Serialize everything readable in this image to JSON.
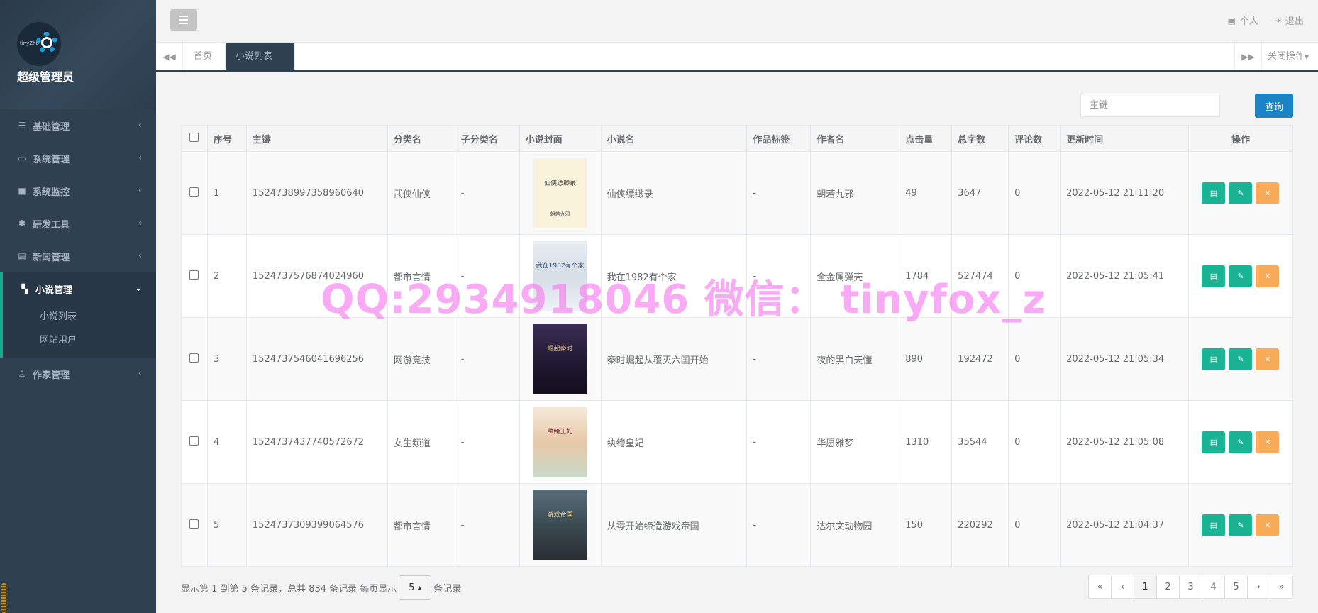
{
  "profile": {
    "role": "超级管理员",
    "avatar_text": "tinyZhb"
  },
  "menu": [
    {
      "label": "基础管理",
      "icon": "list-icon"
    },
    {
      "label": "系统管理",
      "icon": "desktop-icon"
    },
    {
      "label": "系统监控",
      "icon": "video-icon"
    },
    {
      "label": "研发工具",
      "icon": "gear-icon"
    },
    {
      "label": "新闻管理",
      "icon": "newspaper-icon"
    },
    {
      "label": "小说管理",
      "icon": "map-icon",
      "active": true
    },
    {
      "label": "作家管理",
      "icon": "user-icon"
    }
  ],
  "submenu": [
    "小说列表",
    "网站用户"
  ],
  "navbar": {
    "personal": "个人",
    "logout": "退出"
  },
  "tabs": {
    "home": "首页",
    "current": "小说列表",
    "close_ops": "关闭操作"
  },
  "search": {
    "placeholder": "主键",
    "button": "查询"
  },
  "table": {
    "headers": [
      "序号",
      "主键",
      "分类名",
      "子分类名",
      "小说封面",
      "小说名",
      "作品标签",
      "作者名",
      "点击量",
      "总字数",
      "评论数",
      "更新时间",
      "操作"
    ],
    "rows": [
      {
        "no": "1",
        "id": "1524738997358960640",
        "cat": "武侠仙侠",
        "subcat": "-",
        "cover_title": "仙侠缥缈录",
        "cover_author": "朝若九邪",
        "name": "仙侠缥缈录",
        "tag": "-",
        "author": "朝若九邪",
        "clicks": "49",
        "words": "3647",
        "comments": "0",
        "updated": "2022-05-12 21:11:20"
      },
      {
        "no": "2",
        "id": "1524737576874024960",
        "cat": "都市言情",
        "subcat": "-",
        "cover_title": "我在1982有个家",
        "cover_author": "",
        "name": "我在1982有个家",
        "tag": "-",
        "author": "全金属弹壳",
        "clicks": "1784",
        "words": "527474",
        "comments": "0",
        "updated": "2022-05-12 21:05:41"
      },
      {
        "no": "3",
        "id": "1524737546041696256",
        "cat": "网游竞技",
        "subcat": "-",
        "cover_title": "崛起秦时",
        "cover_author": "",
        "name": "秦时崛起从覆灭六国开始",
        "tag": "-",
        "author": "夜的黑白天懂",
        "clicks": "890",
        "words": "192472",
        "comments": "0",
        "updated": "2022-05-12 21:05:34"
      },
      {
        "no": "4",
        "id": "1524737437740572672",
        "cat": "女生频道",
        "subcat": "-",
        "cover_title": "纨绔王妃",
        "cover_author": "",
        "name": "纨绔皇妃",
        "tag": "-",
        "author": "华愿雅梦",
        "clicks": "1310",
        "words": "35544",
        "comments": "0",
        "updated": "2022-05-12 21:05:08"
      },
      {
        "no": "5",
        "id": "1524737309399064576",
        "cat": "都市言情",
        "subcat": "-",
        "cover_title": "游戏帝国",
        "cover_author": "",
        "name": "从零开始缔造游戏帝国",
        "tag": "-",
        "author": "达尔文动物园",
        "clicks": "150",
        "words": "220292",
        "comments": "0",
        "updated": "2022-05-12 21:04:37"
      }
    ]
  },
  "pager": {
    "info_prefix": "显示第 1 到第 5 条记录，总共 834 条记录 每页显示",
    "page_size": "5",
    "info_suffix": "条记录",
    "pages": [
      "«",
      "‹",
      "1",
      "2",
      "3",
      "4",
      "5",
      "›",
      "»"
    ],
    "active_page": "1"
  },
  "watermark": "QQ:2934918046 微信： tinyfox_z",
  "colors": {
    "sidebar": "#2f4050",
    "accent": "#1ab394",
    "primary": "#1c84c6",
    "warning": "#f8ac59"
  }
}
